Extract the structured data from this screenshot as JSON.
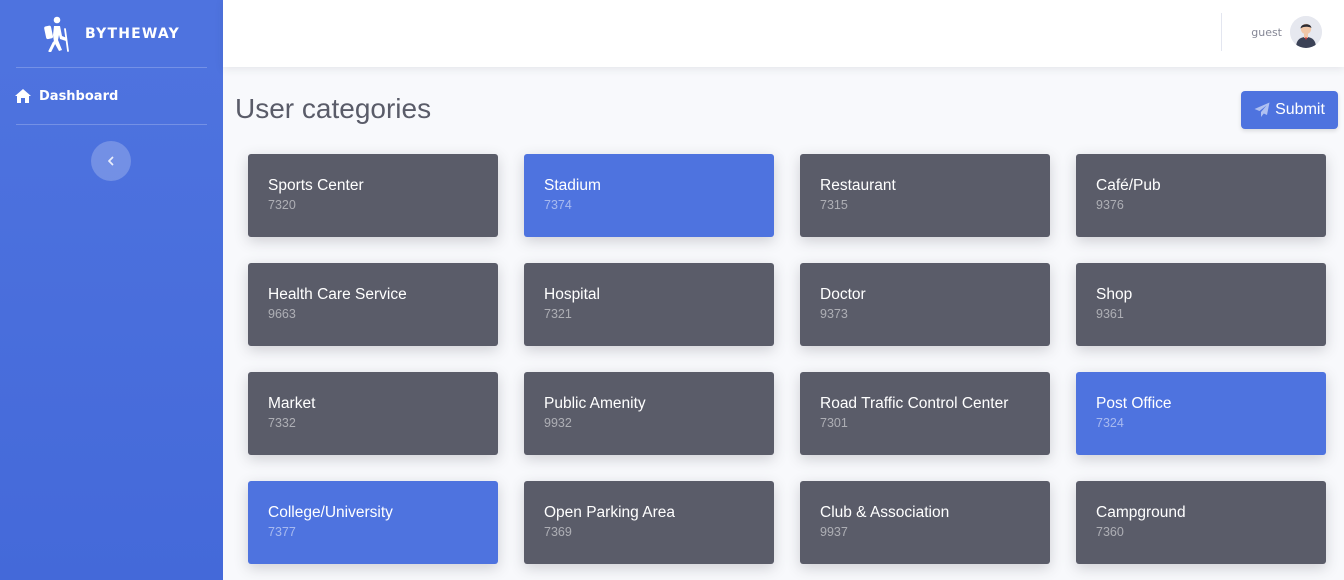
{
  "brand": {
    "name": "BYTHEWAY"
  },
  "sidebar": {
    "items": [
      {
        "label": "Dashboard",
        "icon": "home-icon"
      }
    ],
    "toggle_icon": "chevron-left-icon"
  },
  "topbar": {
    "user_name": "guest"
  },
  "page": {
    "title": "User categories"
  },
  "actions": {
    "submit_label": "Submit"
  },
  "colors": {
    "primary": "#4e73df",
    "card": "#5a5c69",
    "background": "#f8f9fc"
  },
  "categories": [
    {
      "name": "Sports Center",
      "code": "7320",
      "selected": false
    },
    {
      "name": "Stadium",
      "code": "7374",
      "selected": true
    },
    {
      "name": "Restaurant",
      "code": "7315",
      "selected": false
    },
    {
      "name": "Café/Pub",
      "code": "9376",
      "selected": false
    },
    {
      "name": "Health Care Service",
      "code": "9663",
      "selected": false
    },
    {
      "name": "Hospital",
      "code": "7321",
      "selected": false
    },
    {
      "name": "Doctor",
      "code": "9373",
      "selected": false
    },
    {
      "name": "Shop",
      "code": "9361",
      "selected": false
    },
    {
      "name": "Market",
      "code": "7332",
      "selected": false
    },
    {
      "name": "Public Amenity",
      "code": "9932",
      "selected": false
    },
    {
      "name": "Road Traffic Control Center",
      "code": "7301",
      "selected": false
    },
    {
      "name": "Post Office",
      "code": "7324",
      "selected": true
    },
    {
      "name": "College/University",
      "code": "7377",
      "selected": true
    },
    {
      "name": "Open Parking Area",
      "code": "7369",
      "selected": false
    },
    {
      "name": "Club & Association",
      "code": "9937",
      "selected": false
    },
    {
      "name": "Campground",
      "code": "7360",
      "selected": false
    }
  ]
}
